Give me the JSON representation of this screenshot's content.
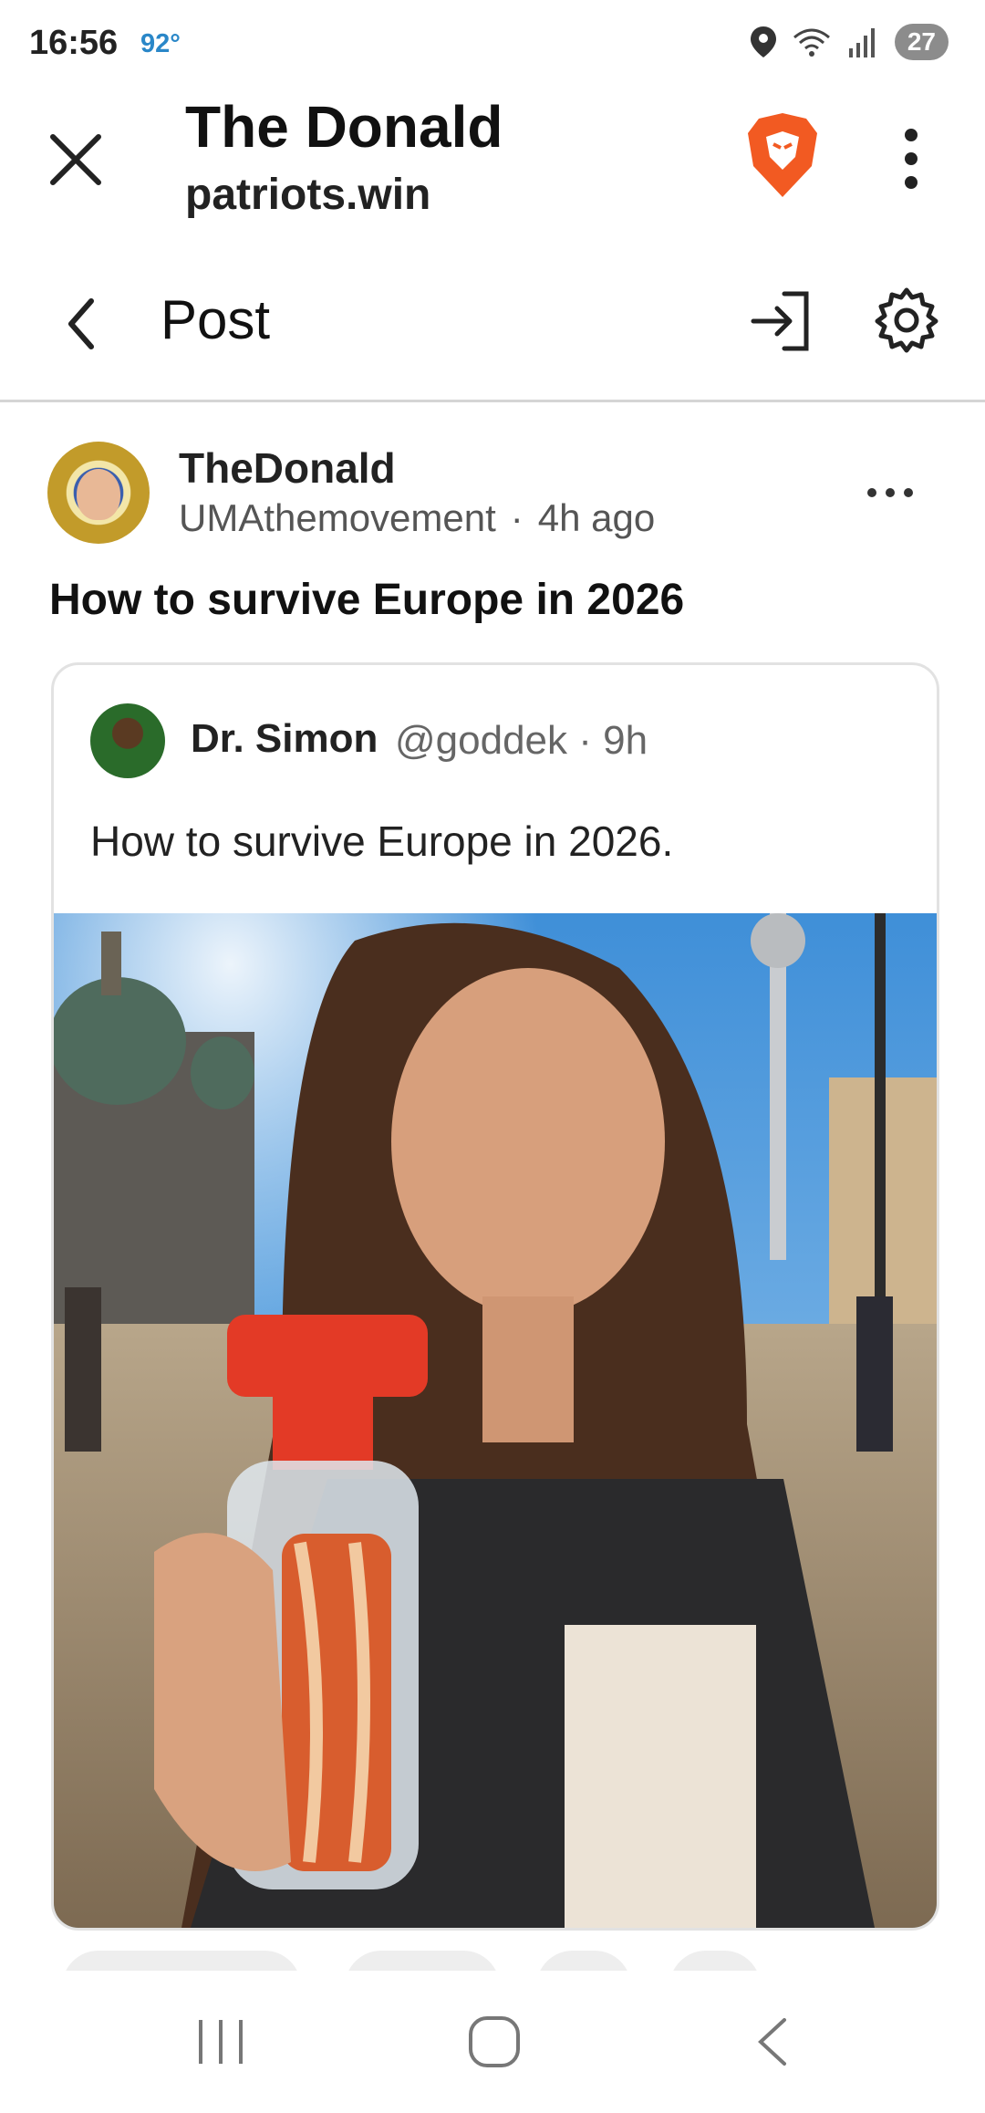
{
  "status_bar": {
    "time": "16:56",
    "temperature": "92°",
    "battery": "27",
    "icons": [
      "location-icon",
      "wifi-icon",
      "signal-icon",
      "battery-icon"
    ]
  },
  "custom_tab": {
    "title": "The Donald",
    "url": "patriots.win",
    "icons": [
      "close-icon",
      "brave-lion-icon",
      "more-vertical-icon"
    ]
  },
  "post_nav": {
    "title": "Post",
    "icons": [
      "back-chevron-icon",
      "login-icon",
      "gear-icon"
    ]
  },
  "post": {
    "community": "TheDonald",
    "username": "UMAthemovement",
    "separator": "·",
    "age": "4h ago",
    "headline": "How to survive Europe in 2026"
  },
  "embed": {
    "name": "Dr. Simon",
    "handle": "@goddek · 9h",
    "text": "How to survive Europe in 2026.",
    "image_description_icon": "photo"
  },
  "colors": {
    "temp_blue": "#2a87c8",
    "brave_orange": "#f25a22",
    "divider": "#d5d5d5"
  },
  "nav_bar": {
    "icons": [
      "recents-icon",
      "home-icon",
      "back-icon"
    ]
  }
}
